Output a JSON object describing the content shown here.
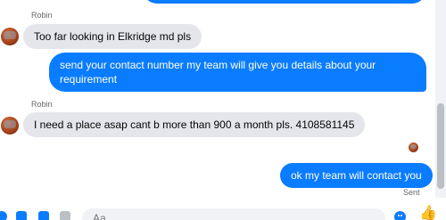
{
  "messages": [
    {
      "sender": "Robin",
      "text": "Too far looking in Elkridge md pls"
    },
    {
      "text": "send your contact number my team will give you details about your requirement"
    },
    {
      "sender": "Robin",
      "text": "I need a place asap cant b more than 900 a month pls.      4108581145"
    },
    {
      "text": "ok my team will contact you",
      "status": "Sent"
    }
  ],
  "composer": {
    "placeholder": "Aa",
    "icons": [
      "add-icon",
      "image-icon",
      "sticker-icon",
      "gif-icon",
      "emoji-icon",
      "like-icon"
    ],
    "like_glyph": "👍"
  },
  "colors": {
    "outgoing": "#0a7cff",
    "incoming": "#e4e6eb"
  }
}
